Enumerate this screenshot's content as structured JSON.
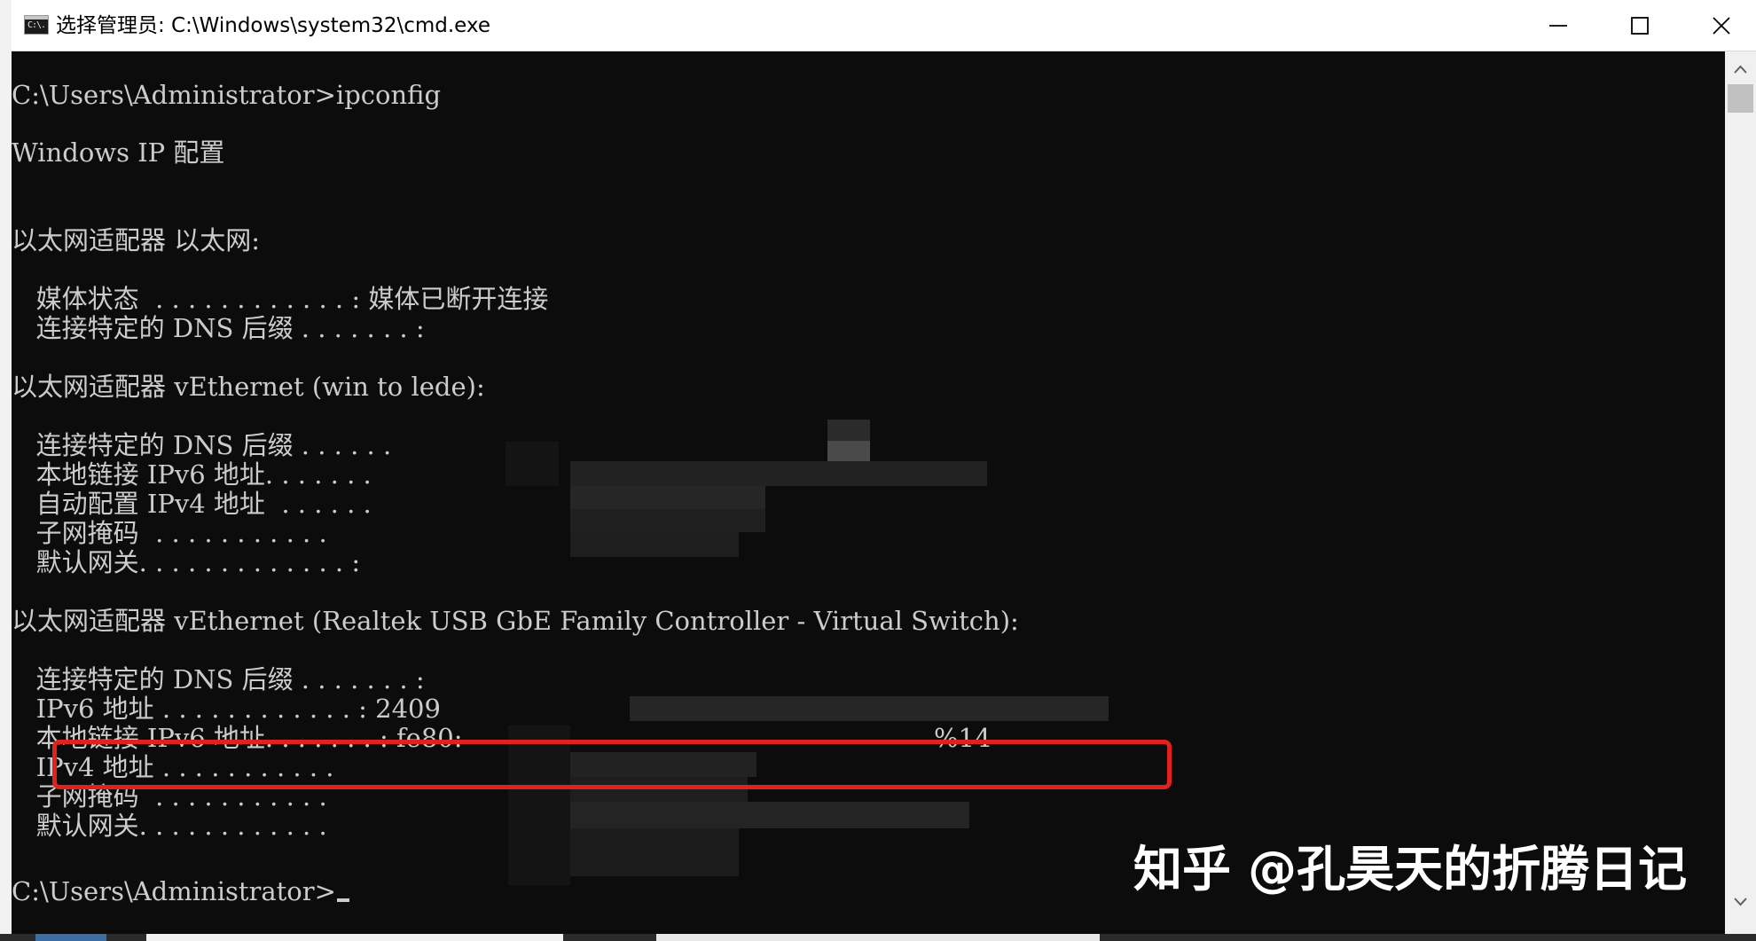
{
  "window": {
    "title": "选择管理员: C:\\Windows\\system32\\cmd.exe",
    "icon": "cmd-icon",
    "icon_text": "C:\\."
  },
  "console": {
    "lines": [
      "C:\\Users\\Administrator>ipconfig",
      "Windows IP 配置",
      "以太网适配器 以太网:",
      "   媒体状态  . . . . . . . . . . . . : 媒体已断开连接",
      "   连接特定的 DNS 后缀 . . . . . . . :",
      "以太网适配器 vEthernet (win to lede):",
      "   连接特定的 DNS 后缀 . . . . . .",
      "   本地链接 IPv6 地址. . . . . . .",
      "   自动配置 IPv4 地址  . . . . . .",
      "   子网掩码  . . . . . . . . . . .",
      "   默认网关. . . . . . . . . . . . . :",
      "以太网适配器 vEthernet (Realtek USB GbE Family Controller - Virtual Switch):",
      "   连接特定的 DNS 后缀 . . . . . . . :",
      "   IPv6 地址 . . . . . . . . . . . . : 2409",
      "   本地链接 IPv6 地址. . . . . . . : fe80:",
      "%14",
      "   IPv4 地址 . . . . . . . . . . .",
      "   子网掩码  . . . . . . . . . . .",
      "   默认网关. . . . . . . . . . . .",
      "C:\\Users\\Administrator>"
    ]
  },
  "watermark": "知乎 @孔昊天的折腾日记",
  "colors": {
    "console_bg": "#0c0c0c",
    "console_text": "#cccccc",
    "highlight": "#e0221c",
    "titlebar_bg": "#ffffff"
  }
}
